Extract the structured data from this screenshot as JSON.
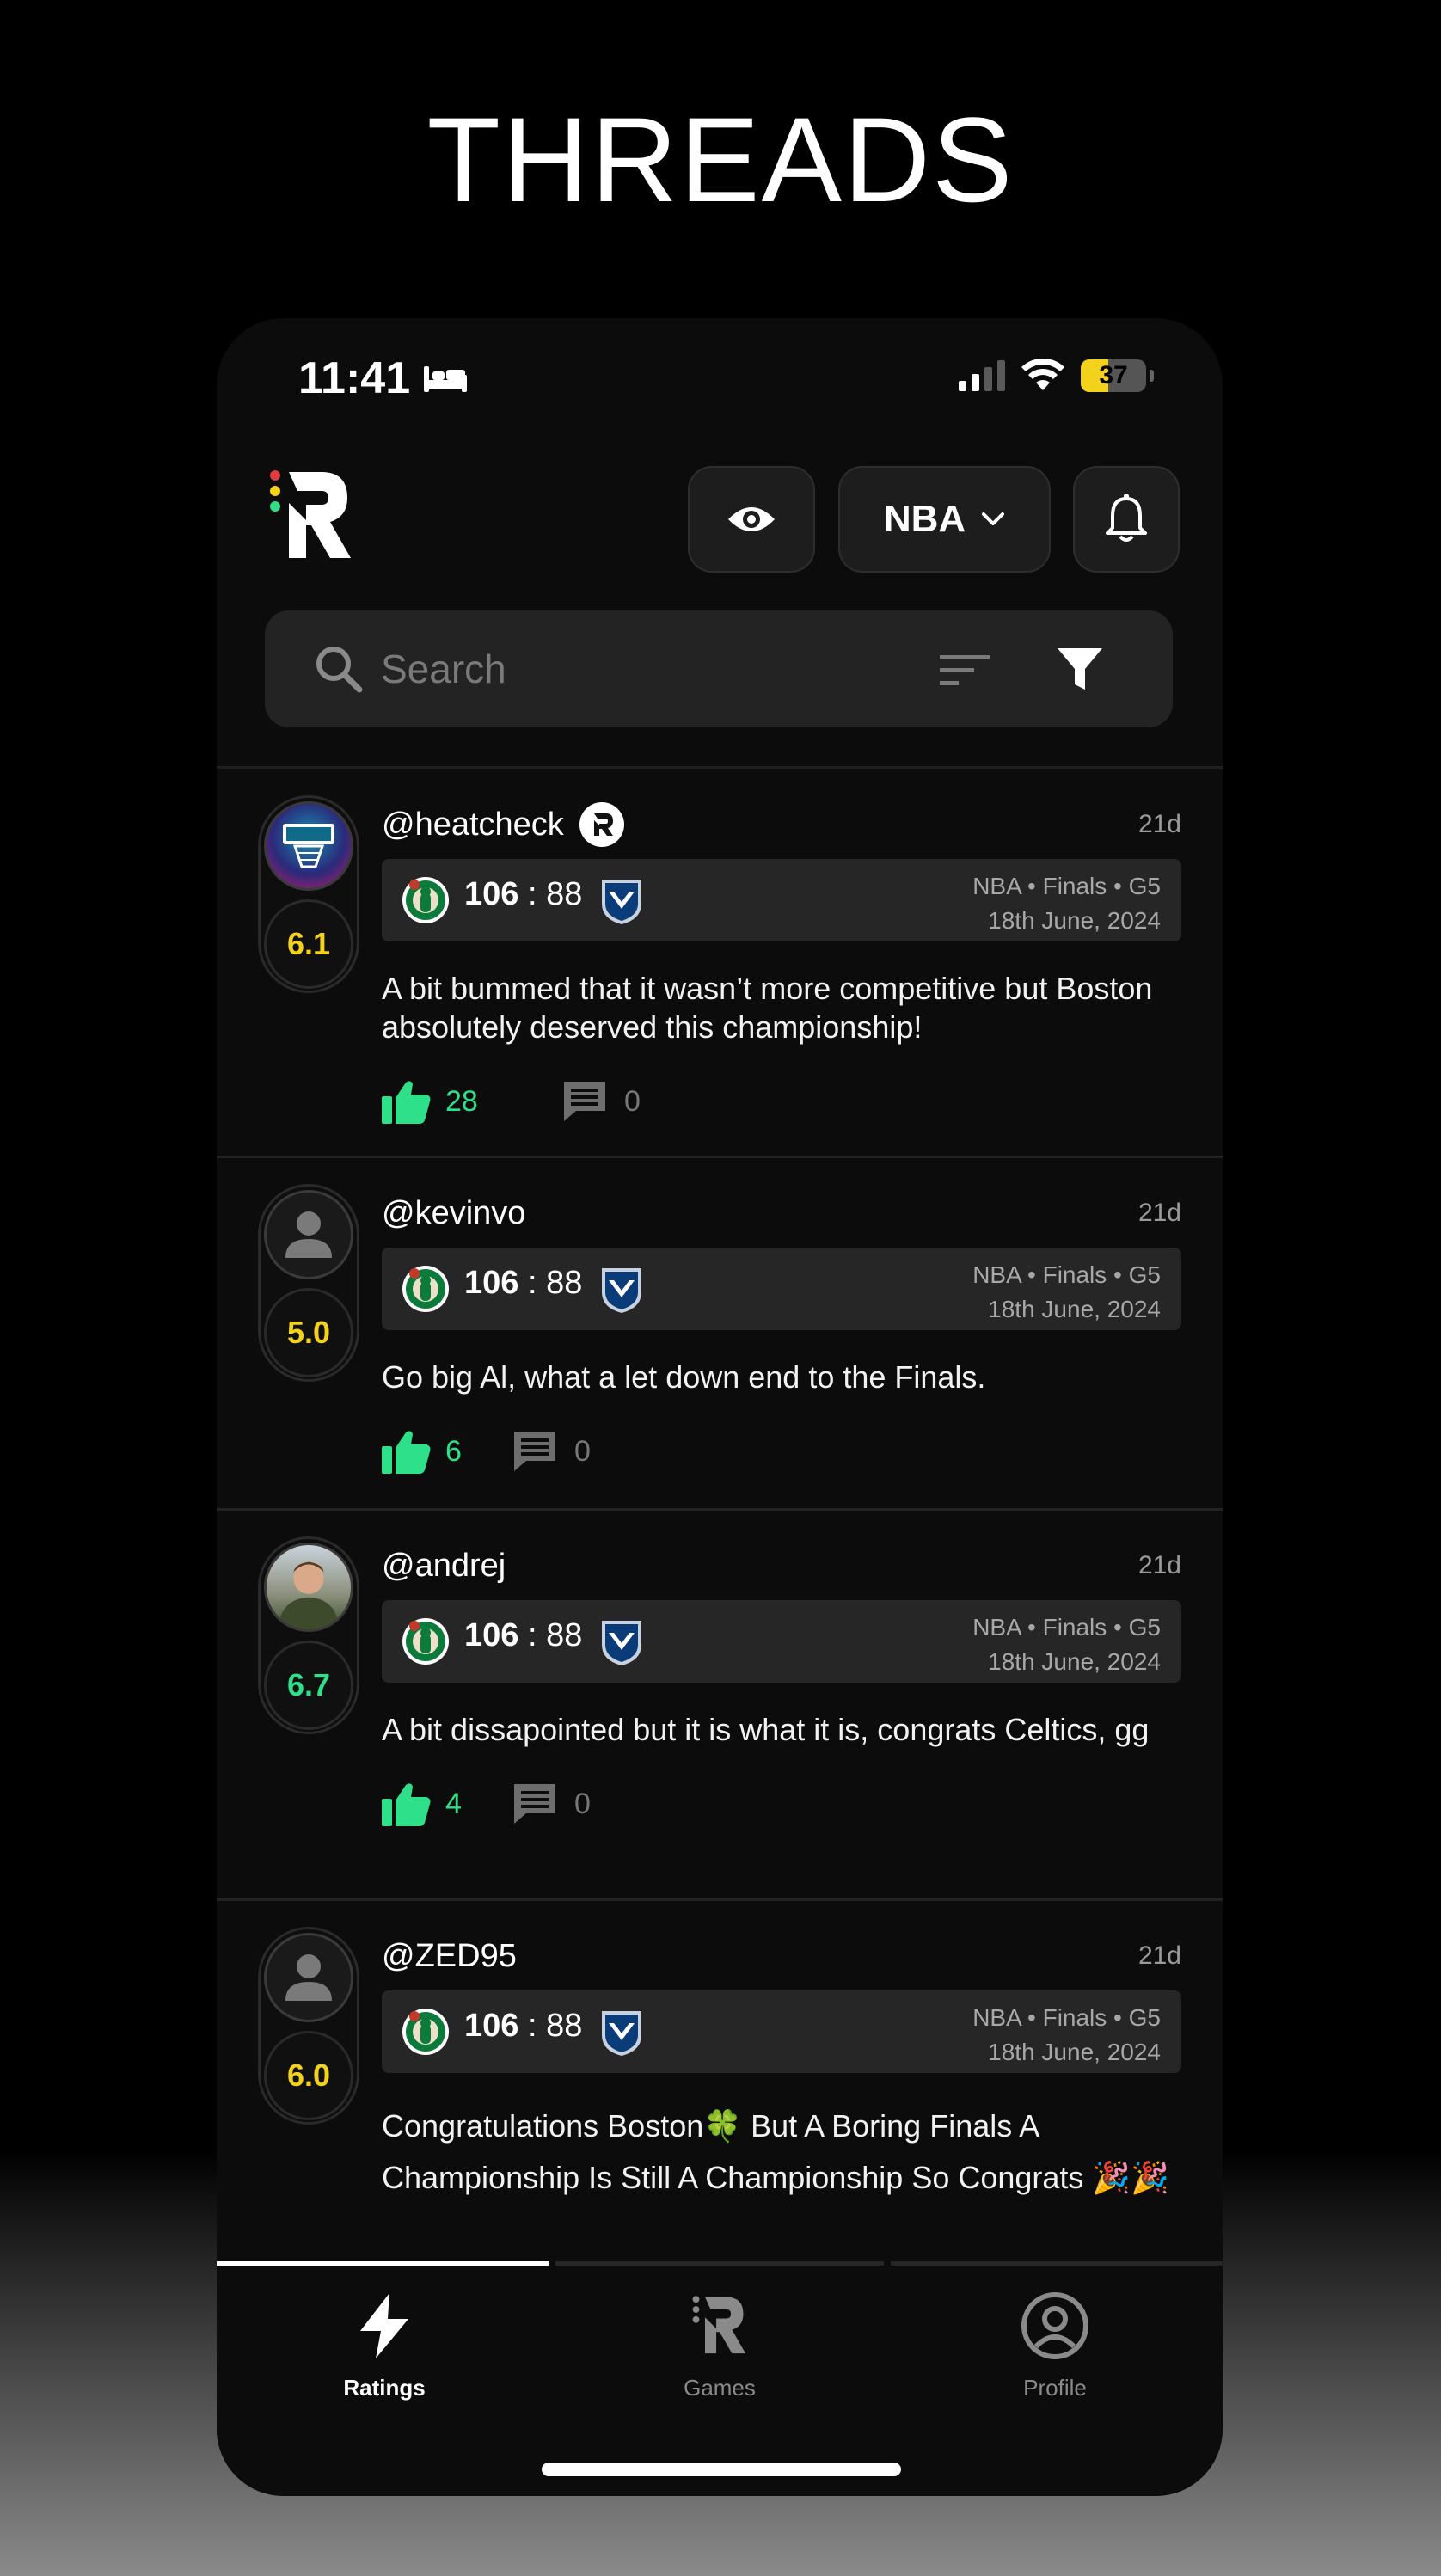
{
  "page_title": "THREADS",
  "status_bar": {
    "time": "11:41",
    "battery": "37"
  },
  "header": {
    "league_label": "NBA"
  },
  "search": {
    "placeholder": "Search"
  },
  "colors": {
    "accent_green": "#2ee08a",
    "score_yellow": "#f2d21a",
    "background": "#0c0c0c"
  },
  "posts": [
    {
      "username": "@heatcheck",
      "verified": true,
      "age": "21d",
      "rating": "6.1",
      "rating_color": "#f2d21a",
      "game": {
        "home_score": "106",
        "separator": ":",
        "away_score": "88",
        "meta_line1": "NBA  •  Finals  •  G5",
        "meta_line2": "18th June, 2024"
      },
      "text": "A bit bummed that it wasn’t more competitive but Boston absolutely deserved this championship!",
      "likes": "28",
      "comments": "0"
    },
    {
      "username": "@kevinvo",
      "verified": false,
      "age": "21d",
      "rating": "5.0",
      "rating_color": "#f2d21a",
      "game": {
        "home_score": "106",
        "separator": ":",
        "away_score": "88",
        "meta_line1": "NBA  •  Finals  •  G5",
        "meta_line2": "18th June, 2024"
      },
      "text": "Go big Al, what a let down end to the Finals.",
      "likes": "6",
      "comments": "0"
    },
    {
      "username": "@andrej",
      "verified": false,
      "age": "21d",
      "rating": "6.7",
      "rating_color": "#2ee08a",
      "game": {
        "home_score": "106",
        "separator": ":",
        "away_score": "88",
        "meta_line1": "NBA  •  Finals  •  G5",
        "meta_line2": "18th June, 2024"
      },
      "text": "A bit dissapointed but it is what it is, congrats Celtics, gg",
      "likes": "4",
      "comments": "0"
    },
    {
      "username": "@ZED95",
      "verified": false,
      "age": "21d",
      "rating": "6.0",
      "rating_color": "#f2d21a",
      "game": {
        "home_score": "106",
        "separator": ":",
        "away_score": "88",
        "meta_line1": "NBA  •  Finals  •  G5",
        "meta_line2": "18th June, 2024"
      },
      "text": "Congratulations Boston🍀 But A Boring Finals A Championship Is Still A Championship So Congrats 🎉🎉",
      "likes": "",
      "comments": ""
    }
  ],
  "tabs": [
    {
      "label": "Ratings",
      "icon": "bolt-icon",
      "active": true
    },
    {
      "label": "Games",
      "icon": "r-logo-icon",
      "active": false
    },
    {
      "label": "Profile",
      "icon": "profile-icon",
      "active": false
    }
  ]
}
